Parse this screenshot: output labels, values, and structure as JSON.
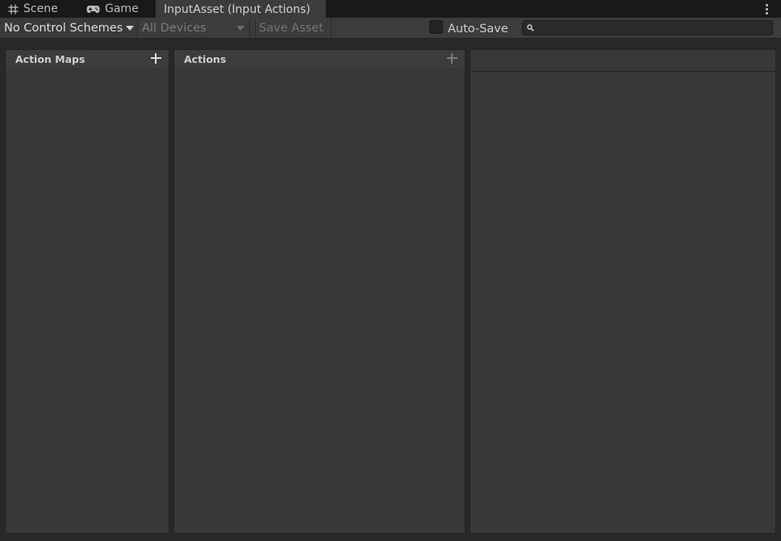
{
  "tabs": [
    {
      "label": "Scene",
      "icon": "grid-hash-icon"
    },
    {
      "label": "Game",
      "icon": "gamepad-icon"
    },
    {
      "label": "InputAsset (Input Actions)",
      "active": true
    }
  ],
  "toolbar": {
    "control_schemes": "No Control Schemes",
    "devices": "All Devices",
    "save_asset": "Save Asset",
    "auto_save_label": "Auto-Save",
    "auto_save_checked": false,
    "search_placeholder": ""
  },
  "panels": {
    "action_maps": {
      "title": "Action Maps"
    },
    "actions": {
      "title": "Actions"
    }
  },
  "colors": {
    "background": "#282828",
    "panel": "#383838",
    "toolbar": "#3c3c3c",
    "tabbar": "#191919"
  }
}
